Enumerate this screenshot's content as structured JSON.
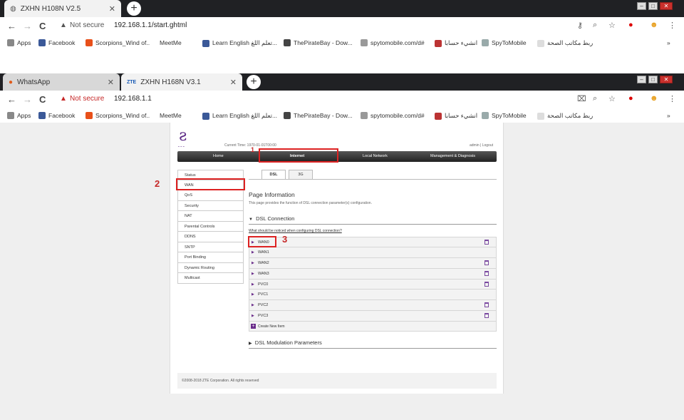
{
  "browser1": {
    "tab_title": "ZXHN H108N V2.5",
    "nav": {
      "back": "←",
      "forward": "→",
      "reload": "C"
    },
    "security_label": "Not secure",
    "url": "192.168.1.1/start.ghtml"
  },
  "browser2": {
    "tab1_title": "WhatsApp",
    "tab2_title": "ZXHN H168N V3.1",
    "tab2_logo": "ZTE",
    "security_label": "Not secure",
    "url": "192.168.1.1"
  },
  "bookmarks": [
    "Apps",
    "Facebook",
    "Scorpions_Wind of...",
    "MeetMe",
    "Learn English تعلم اللغ...",
    "ThePirateBay - Dow...",
    "spytomobile.com/d#",
    "انشيء حسابا",
    "SpyToMobile",
    "ربط مكاتب الصحة"
  ],
  "router": {
    "current_time": "Current Time: 1970-01-01T00:00",
    "admin": "admin",
    "logout": "Logout",
    "menu": [
      "Home",
      "Internet",
      "Local Network",
      "Management & Diagnosis"
    ],
    "sidebar": [
      "Status",
      "WAN",
      "QoS",
      "Security",
      "NAT",
      "Parental Controls",
      "DDNS",
      "SNTP",
      "Port Binding",
      "Dynamic Routing",
      "Multicast"
    ],
    "subtabs": [
      "DSL",
      "3G"
    ],
    "page_title": "Page Information",
    "page_desc": "This page provides the function of DSL connection parameter(s) configuration.",
    "section1": "DSL Connection",
    "notice_link": "What should be noticed when configuring DSL connection?",
    "connections": [
      {
        "name": "WAN0",
        "deletable": true
      },
      {
        "name": "WAN1",
        "deletable": false
      },
      {
        "name": "WAN2",
        "deletable": true
      },
      {
        "name": "WAN3",
        "deletable": true
      },
      {
        "name": "PVC0",
        "deletable": true
      },
      {
        "name": "PVC1",
        "deletable": false
      },
      {
        "name": "PVC2",
        "deletable": true
      },
      {
        "name": "PVC3",
        "deletable": true
      }
    ],
    "create_new": "Create New Item",
    "section2": "DSL Modulation Parameters",
    "footer": "©2008-2018 ZTE Corporation. All rights reserved"
  },
  "annotations": {
    "n1": "1",
    "n2": "2",
    "n3": "3"
  }
}
